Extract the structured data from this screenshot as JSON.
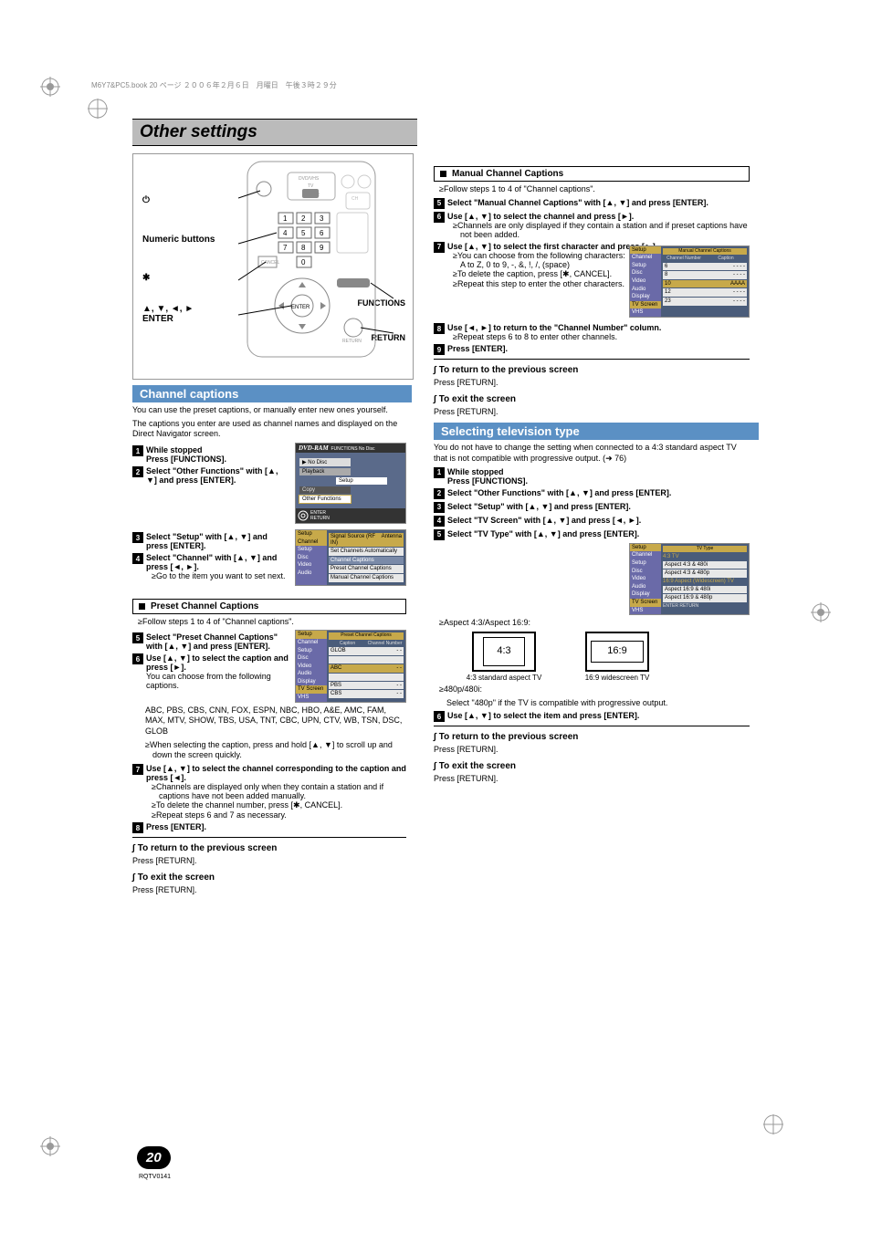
{
  "meta": {
    "print_header": "M6Y7&PC5.book  20 ページ  ２００６年２月６日　月曜日　午後３時２９分"
  },
  "title": "Other settings",
  "page_num": "20",
  "page_code": "RQTV0141",
  "remote": {
    "label_numeric": "Numeric buttons",
    "label_arrows": "▲, ▼, ◄, ►\nENTER",
    "label_functions": "FUNCTIONS",
    "label_return": "RETURN",
    "label_power": "⏻",
    "label_star": "✱"
  },
  "cc": {
    "header": "Channel captions",
    "intro1": "You can use the preset captions, or manually enter new ones yourself.",
    "intro2": "The captions you enter are used as channel names and displayed on the Direct Navigator screen.",
    "s1_pre": "While stopped",
    "s1": "Press [FUNCTIONS].",
    "s2": "Select \"Other Functions\" with [▲, ▼] and press [ENTER].",
    "s3": "Select \"Setup\" with [▲, ▼] and press [ENTER].",
    "s4": "Select \"Channel\" with [▲, ▼] and press [◄, ►].",
    "s4_note": "Go to the item you want to set next.",
    "preset_header": "Preset Channel Captions",
    "preset_intro": "Follow steps 1 to 4 of \"Channel captions\".",
    "s5": "Select \"Preset Channel Captions\" with [▲, ▼] and press [ENTER].",
    "s6": "Use [▲, ▼] to select the caption and press [►].",
    "s6_note1": "You can choose from the following captions.",
    "s6_note2": "ABC, PBS, CBS, CNN, FOX, ESPN, NBC, HBO, A&E, AMC, FAM, MAX, MTV, SHOW, TBS, USA, TNT, CBC, UPN, CTV, WB, TSN, DSC, GLOB",
    "s6_bullet": "When selecting the caption, press and hold [▲, ▼] to scroll up and down the screen quickly.",
    "s7": "Use [▲, ▼] to select the channel corresponding to the caption and press [◄].",
    "s7_b1": "Channels are displayed only when they contain a station and if captions have not been added manually.",
    "s7_b2": "To delete the channel number, press [✱, CANCEL].",
    "s7_b3": "Repeat steps 6 and 7 as necessary.",
    "s8": "Press [ENTER].",
    "return_screen": "To return to the previous screen",
    "press_return": "Press [RETURN].",
    "exit_screen": "To exit the screen"
  },
  "mcc": {
    "header": "Manual Channel Captions",
    "intro": "Follow steps 1 to 4 of \"Channel captions\".",
    "s5": "Select \"Manual Channel Captions\" with [▲, ▼] and press [ENTER].",
    "s6": "Use [▲, ▼] to select the channel and press [►].",
    "s6_b": "Channels are only displayed if they contain a station and if preset captions have not been added.",
    "s7": "Use [▲, ▼] to select the first character and press [►].",
    "s7_b1": "You can choose from the following characters:",
    "s7_b2": "A to Z, 0 to 9, -, &, !, /, (space)",
    "s7_b3": "To delete the caption, press [✱, CANCEL].",
    "s7_b4": "Repeat this step to enter the other characters.",
    "s8": "Use [◄, ►] to return to the \"Channel Number\" column.",
    "s8_b": "Repeat steps 6 to 8 to enter other channels.",
    "s9": "Press [ENTER].",
    "return_screen": "To return to the previous screen",
    "press_return": "Press [RETURN].",
    "exit_screen": "To exit the screen"
  },
  "tv": {
    "header": "Selecting television type",
    "intro": "You do not have to change the setting when connected to a 4:3 standard aspect TV that is not compatible with progressive output. (➜ 76)",
    "s1_pre": "While stopped",
    "s1": "Press [FUNCTIONS].",
    "s2": "Select \"Other Functions\" with [▲, ▼] and press [ENTER].",
    "s3": "Select \"Setup\" with [▲, ▼] and press [ENTER].",
    "s4": "Select \"TV Screen\" with [▲, ▼] and press [◄, ►].",
    "s5": "Select \"TV Type\" with [▲, ▼] and press [ENTER].",
    "aspect_line": "Aspect 4:3/Aspect 16:9:",
    "cap43": "4:3 standard aspect TV",
    "cap169": "16:9 widescreen TV",
    "label43": "4:3",
    "label169": "16:9",
    "prog_line": "480p/480i:",
    "prog_desc": "Select \"480p\" if the TV is compatible with progressive output.",
    "s6": "Use [▲, ▼] to select the item and press [ENTER].",
    "return_screen": "To return to the previous screen",
    "press_return": "Press [RETURN].",
    "exit_screen": "To exit the screen"
  },
  "osd_menu": {
    "items": [
      "Channel",
      "Setup",
      "Disc",
      "Video",
      "Audio",
      "Display",
      "TV Screen",
      "VHS"
    ]
  },
  "osd_functions": {
    "top": "FUNCTIONS    No Disc",
    "nodisc": "▶ No Disc",
    "playback": "Playback",
    "setup": "Setup",
    "copy": "Copy",
    "other": "Other Functions",
    "hint": "ENTER\nRETURN"
  },
  "osd_channel": {
    "title_top": "Signal Source (RF IN)",
    "title_top_r": "Antenna",
    "items": [
      "Set Channels Automatically",
      "Channel Captions",
      "Preset Channel Captions",
      "Manual Channel Captions"
    ]
  },
  "osd_preset": {
    "title": "Preset Channel Captions",
    "cols": [
      "Caption",
      "Channel Number"
    ],
    "rows": [
      [
        "GLOB",
        "- -"
      ],
      [
        "",
        ""
      ],
      [
        "ABC",
        "- -"
      ],
      [
        "",
        ""
      ],
      [
        "PBS",
        "- -"
      ],
      [
        "CBS",
        "- -"
      ]
    ]
  },
  "osd_manual": {
    "title": "Manual Channel Captions",
    "cols": [
      "Channel Number",
      "Caption"
    ],
    "rows": [
      [
        "6",
        "- - - -"
      ],
      [
        "8",
        "- - - -"
      ],
      [
        "10",
        "AAAA"
      ],
      [
        "12",
        "- - - -"
      ],
      [
        "23",
        "- - - -"
      ]
    ]
  },
  "osd_tvtype": {
    "title": "TV Type",
    "group1": "4:3 TV",
    "items1": [
      "Aspect 4:3 & 480i",
      "Aspect 4:3 & 480p"
    ],
    "group2": "16:9 Aspect (Widescreen) TV",
    "items2": [
      "Aspect 16:9 & 480i",
      "Aspect 16:9 & 480p"
    ]
  }
}
